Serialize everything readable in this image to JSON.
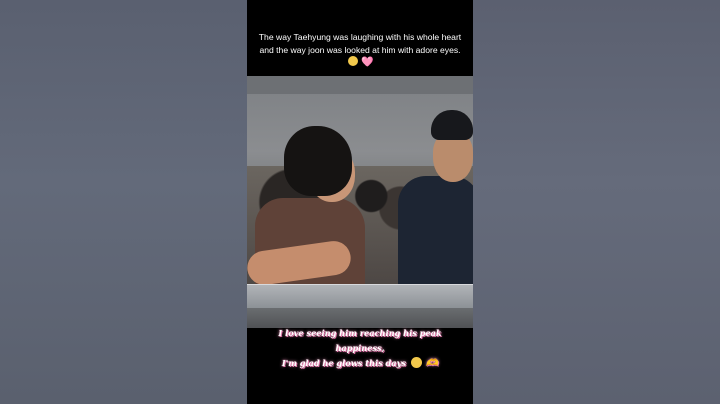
{
  "caption_top": "The way Taehyung was laughing with his whole heart and the way joon was looked at him with adore eyes.",
  "caption_top_emoji_1": "🥺",
  "caption_top_emoji_2": "🩷",
  "caption_bottom_line_1": "I love seeing him reaching his peak happiness,",
  "caption_bottom_line_2": "I'm glad he glows this days",
  "caption_bottom_emoji_1": "😭",
  "caption_bottom_emoji_2": "🫶",
  "colors": {
    "background": "#5b6170",
    "phone_bg": "#000000",
    "caption_glow": "#f09ac1"
  }
}
